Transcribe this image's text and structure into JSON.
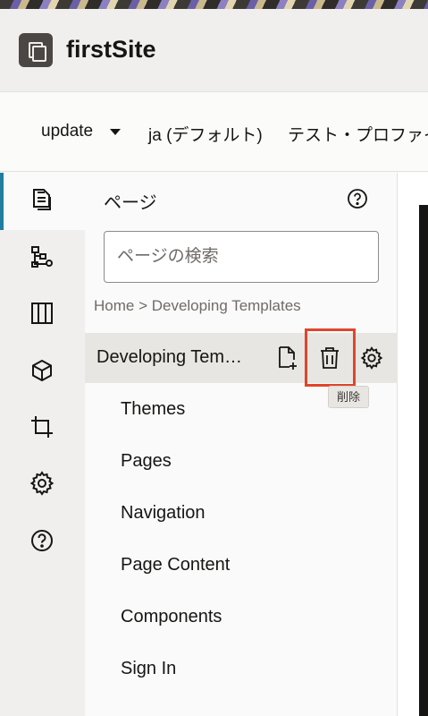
{
  "app": {
    "site_name": "firstSite",
    "logo_icon": "site-logo-icon"
  },
  "context_bar": {
    "site_selector": "update",
    "language": "ja (デフォルト)",
    "profile": "テスト・プロファイ"
  },
  "side_rail": {
    "items": [
      {
        "icon": "pages-icon",
        "active": true
      },
      {
        "icon": "structure-icon",
        "active": false
      },
      {
        "icon": "layouts-icon",
        "active": false
      },
      {
        "icon": "components-icon",
        "active": false
      },
      {
        "icon": "crop-icon",
        "active": false
      },
      {
        "icon": "settings-icon",
        "active": false
      },
      {
        "icon": "help-icon",
        "active": false
      }
    ],
    "accent_color": "#227e9e"
  },
  "panel": {
    "title": "ページ",
    "help_icon": "help-icon",
    "search_placeholder": "ページの検索",
    "breadcrumb": "Home > Developing Templates",
    "selected_page": {
      "label": "Developing Tem…",
      "actions": [
        "add-page-icon",
        "delete-icon",
        "settings-icon"
      ],
      "delete_tooltip": "削除"
    },
    "child_pages": [
      "Themes",
      "Pages",
      "Navigation",
      "Page Content",
      "Components",
      "Sign In"
    ]
  },
  "highlight_color": "#e0452b"
}
